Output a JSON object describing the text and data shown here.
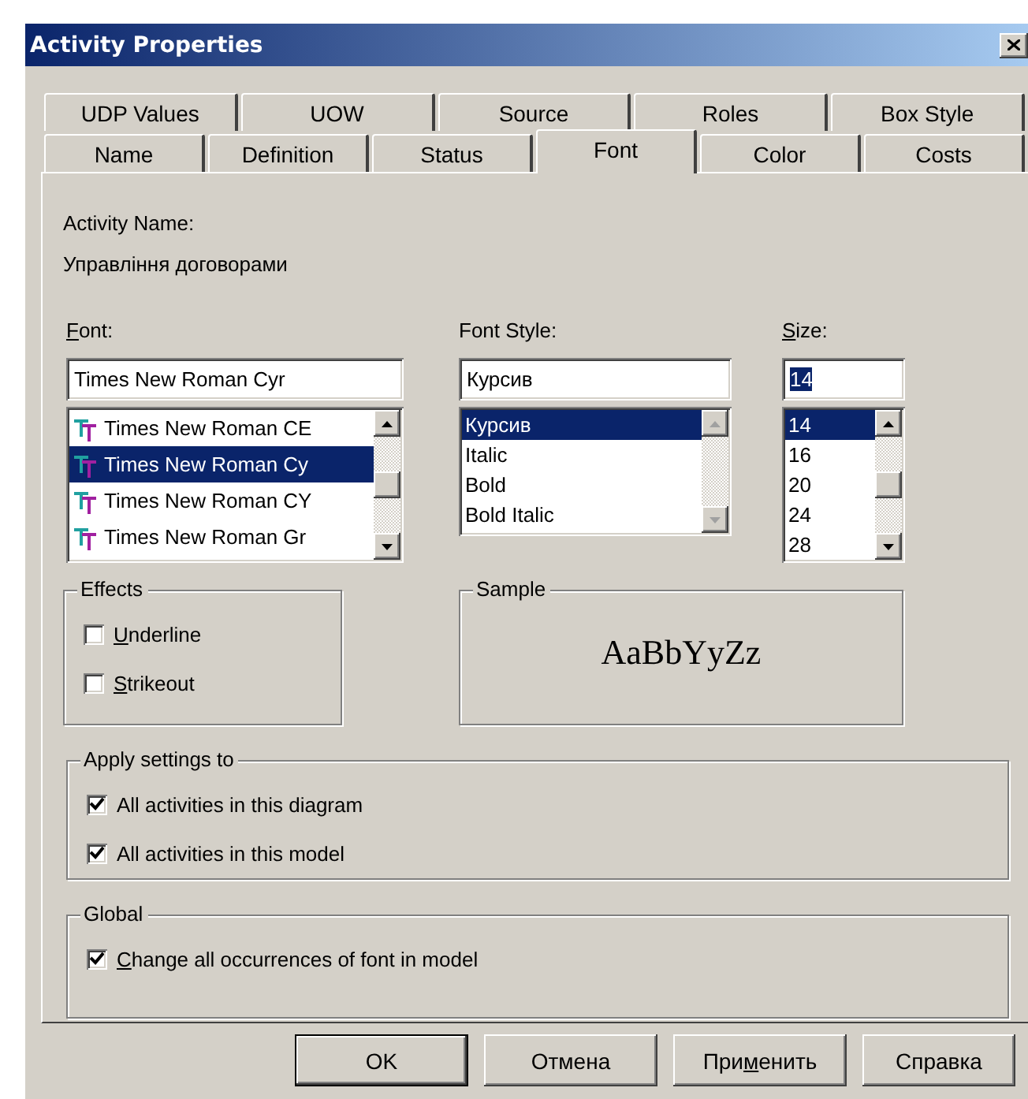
{
  "window": {
    "title": "Activity Properties"
  },
  "tab_rows": [
    {
      "tabs": [
        {
          "label": "UDP Values",
          "selected": false
        },
        {
          "label": "UOW",
          "selected": false
        },
        {
          "label": "Source",
          "selected": false
        },
        {
          "label": "Roles",
          "selected": false
        },
        {
          "label": "Box Style",
          "selected": false
        }
      ]
    },
    {
      "tabs": [
        {
          "label": "Name",
          "selected": false
        },
        {
          "label": "Definition",
          "selected": false
        },
        {
          "label": "Status",
          "selected": false
        },
        {
          "label": "Font",
          "selected": true
        },
        {
          "label": "Color",
          "selected": false
        },
        {
          "label": "Costs",
          "selected": false
        }
      ]
    }
  ],
  "activity_name": {
    "label": "Activity Name:",
    "value": "Управління договорами"
  },
  "font": {
    "label_parts": {
      "accel": "F",
      "after": "ont:"
    },
    "value": "Times New Roman Cyr",
    "value_highlighted": false,
    "scrollbar_disabled": false,
    "items": [
      {
        "label": "Times New Roman CE",
        "selected": false
      },
      {
        "label": "Times New Roman Cy",
        "selected": true
      },
      {
        "label": "Times New Roman CY",
        "selected": false
      },
      {
        "label": "Times New Roman Gr",
        "selected": false
      }
    ]
  },
  "font_style": {
    "label_parts": {
      "before": "Font Style:"
    },
    "value": "Курсив",
    "value_highlighted": false,
    "scrollbar_disabled": true,
    "items": [
      {
        "label": "Курсив",
        "selected": true
      },
      {
        "label": "Italic",
        "selected": false
      },
      {
        "label": "Bold",
        "selected": false
      },
      {
        "label": "Bold Italic",
        "selected": false
      }
    ]
  },
  "size": {
    "label_parts": {
      "accel": "S",
      "after": "ize:"
    },
    "value": "14",
    "value_highlighted": true,
    "scrollbar_disabled": false,
    "items": [
      {
        "label": "14",
        "selected": true
      },
      {
        "label": "16",
        "selected": false
      },
      {
        "label": "20",
        "selected": false
      },
      {
        "label": "24",
        "selected": false
      },
      {
        "label": "28",
        "selected": false
      }
    ]
  },
  "effects": {
    "title": "Effects",
    "options": [
      {
        "label_parts": {
          "accel": "U",
          "after": "nderline"
        },
        "checked": false
      },
      {
        "label_parts": {
          "accel": "S",
          "after": "trikeout"
        },
        "checked": false
      }
    ]
  },
  "sample": {
    "title": "Sample",
    "text": "AaBbYyZz"
  },
  "apply_settings": {
    "title": "Apply settings to",
    "options": [
      {
        "label_parts": {
          "before": "All activities in this diagram"
        },
        "checked": true
      },
      {
        "label_parts": {
          "before": "All activities in this model"
        },
        "checked": true
      }
    ]
  },
  "global": {
    "title": "Global",
    "options": [
      {
        "label_parts": {
          "accel": "C",
          "after": "hange all occurrences of font in model"
        },
        "checked": true
      }
    ]
  },
  "buttons": [
    {
      "label_parts": {
        "before": "OK"
      },
      "default": true
    },
    {
      "label_parts": {
        "before": "Отмена"
      },
      "default": false
    },
    {
      "label_parts": {
        "before": "При",
        "accel": "м",
        "after": "енить"
      },
      "default": false
    },
    {
      "label_parts": {
        "before": "Справка"
      },
      "default": false
    }
  ]
}
